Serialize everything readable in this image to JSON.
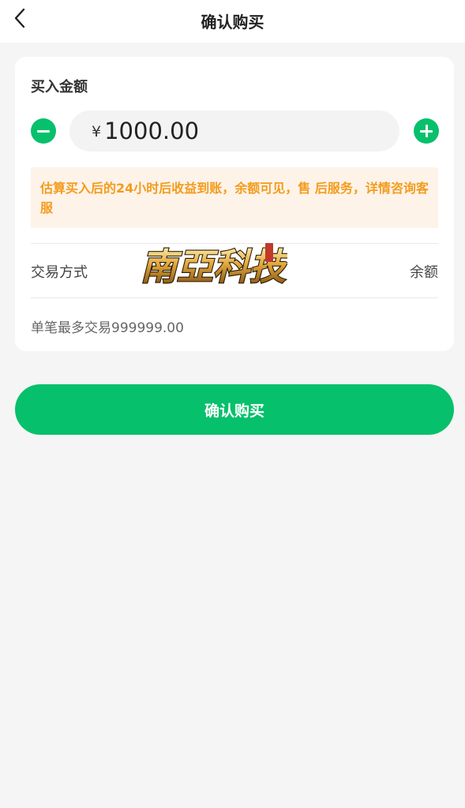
{
  "header": {
    "title": "确认购买"
  },
  "purchase": {
    "section_title": "买入金额",
    "currency_symbol": "¥",
    "amount": "1000.00",
    "notice": "估算买入后的24小时后收益到账，余额可见，售 后服务，详情咨询客服",
    "payment_label": "交易方式",
    "payment_value": "余额",
    "limit_text": "单笔最多交易999999.00"
  },
  "watermark": {
    "text": "南亞科技"
  },
  "footer": {
    "confirm_label": "确认购买"
  },
  "colors": {
    "accent": "#07c06c",
    "notice_text": "#f39c1d",
    "notice_bg": "#fdf3e9",
    "page_bg": "#f5f5f5"
  },
  "icons": {
    "back": "chevron-left-icon",
    "minus": "minus-circle-icon",
    "plus": "plus-circle-icon"
  }
}
